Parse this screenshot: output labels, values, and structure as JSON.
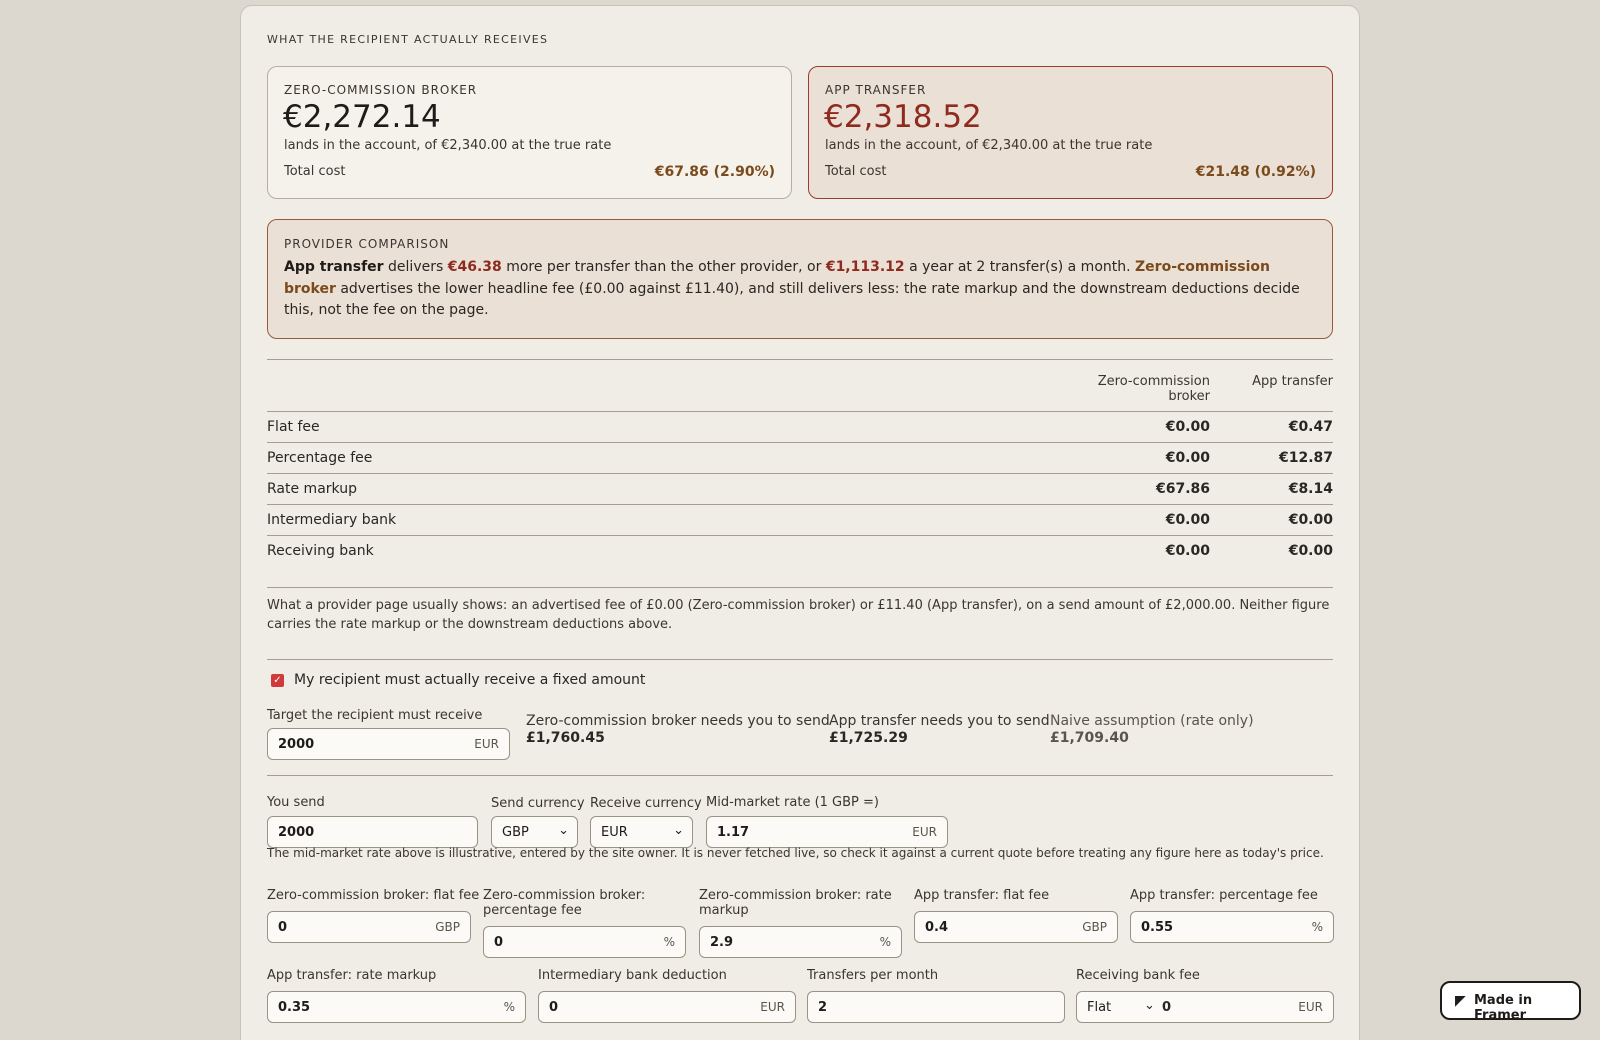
{
  "section_title": "WHAT THE RECIPIENT ACTUALLY RECEIVES",
  "cards": [
    {
      "label": "ZERO-COMMISSION BROKER",
      "amount": "€2,272.14",
      "sub": "lands in the account, of €2,340.00 at the true rate",
      "total_label": "Total cost",
      "total_value": "€67.86 (2.90%)"
    },
    {
      "label": "APP TRANSFER",
      "amount": "€2,318.52",
      "sub": "lands in the account, of €2,340.00 at the true rate",
      "total_label": "Total cost",
      "total_value": "€21.48 (0.92%)"
    }
  ],
  "comparison": {
    "label": "PROVIDER COMPARISON",
    "winner": "App transfer",
    "t1": " delivers ",
    "diff": "€46.38",
    "t2": " more per transfer than the other provider, or ",
    "yearly": "€1,113.12",
    "t3": " a year at 2 transfer(s) a month. ",
    "loser": "Zero-commission broker",
    "t4": " advertises the lower headline fee (£0.00 against £11.40), and still delivers less: the rate markup and the downstream deductions decide this, not the fee on the page."
  },
  "table": {
    "col1": "Zero-commission broker",
    "col2": "App transfer",
    "rows": [
      {
        "label": "Flat fee",
        "v1": "€0.00",
        "v2": "€0.47"
      },
      {
        "label": "Percentage fee",
        "v1": "€0.00",
        "v2": "€12.87"
      },
      {
        "label": "Rate markup",
        "v1": "€67.86",
        "v2": "€8.14"
      },
      {
        "label": "Intermediary bank",
        "v1": "€0.00",
        "v2": "€0.00"
      },
      {
        "label": "Receiving bank",
        "v1": "€0.00",
        "v2": "€0.00"
      }
    ]
  },
  "note": "What a provider page usually shows: an advertised fee of £0.00 (Zero-commission broker) or £11.40 (App transfer), on a send amount of £2,000.00. Neither figure carries the rate markup or the downstream deductions above.",
  "fixed": {
    "checkbox_label": "My recipient must actually receive a fixed amount",
    "checked": true,
    "target_label": "Target the recipient must receive",
    "target_value": "2000",
    "target_unit": "EUR",
    "results": [
      {
        "title": "Zero-commission broker needs you to send",
        "value": "£1,760.45"
      },
      {
        "title": "App transfer needs you to send",
        "value": "£1,725.29"
      },
      {
        "title": "Naive assumption (rate only)",
        "value": "£1,709.40"
      }
    ]
  },
  "inputs": {
    "you_send_label": "You send",
    "you_send": "2000",
    "send_currency_label": "Send currency",
    "send_currency": "GBP",
    "receive_currency_label": "Receive currency",
    "receive_currency": "EUR",
    "rate_label": "Mid-market rate (1 GBP =)",
    "rate": "1.17",
    "rate_unit": "EUR",
    "rate_note": "The mid-market rate above is illustrative, entered by the site owner. It is never fetched live, so check it against a current quote before treating any figure here as today's price.",
    "zc_flat_label": "Zero-commission broker: flat fee",
    "zc_flat": "0",
    "zc_flat_unit": "GBP",
    "zc_pct_label_1": "Zero-commission broker:",
    "zc_pct_label_2": "percentage fee",
    "zc_pct": "0",
    "zc_pct_unit": "%",
    "zc_markup_label_1": "Zero-commission broker: rate",
    "zc_markup_label_2": "markup",
    "zc_markup": "2.9",
    "zc_markup_unit": "%",
    "app_flat_label": "App transfer: flat fee",
    "app_flat": "0.4",
    "app_flat_unit": "GBP",
    "app_pct_label": "App transfer: percentage fee",
    "app_pct": "0.55",
    "app_pct_unit": "%",
    "app_markup_label": "App transfer: rate markup",
    "app_markup": "0.35",
    "app_markup_unit": "%",
    "inter_label": "Intermediary bank deduction",
    "inter": "0",
    "inter_unit": "EUR",
    "tpm_label": "Transfers per month",
    "tpm": "2",
    "rbf_label": "Receiving bank fee",
    "rbf_type": "Flat",
    "rbf": "0",
    "rbf_unit": "EUR"
  },
  "badge": {
    "icon": "framer-icon",
    "label": "Made in Framer"
  }
}
